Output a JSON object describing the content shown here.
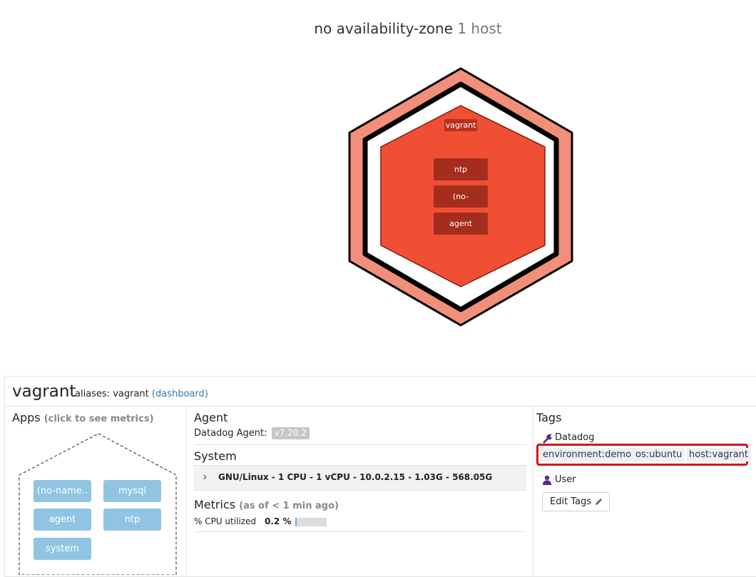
{
  "map": {
    "zone_title": "no availability-zone",
    "zone_count": "1 host",
    "host_label": "vagrant",
    "apps": [
      "ntp",
      "(no-",
      "agent"
    ],
    "colors": {
      "outer": "#f28f7a",
      "inner": "#f04f34",
      "app": "#a52d1d"
    }
  },
  "panel": {
    "host_name": "vagrant",
    "aliases_label": "aliases: vagrant",
    "dashboard_link": "(dashboard)",
    "apps": {
      "title": "Apps",
      "hint": "(click to see metrics)",
      "items": [
        "(no-name..",
        "mysql",
        "agent",
        "ntp",
        "system"
      ]
    },
    "agent": {
      "title": "Agent",
      "label": "Datadog Agent:",
      "version": "v7.20.2"
    },
    "system": {
      "title": "System",
      "summary": "GNU/Linux - 1 CPU - 1 vCPU - 10.0.2.15 - 1.03G - 568.05G"
    },
    "metrics": {
      "title": "Metrics",
      "as_of": "(as of < 1 min ago)",
      "cpu_label": "% CPU utilized",
      "cpu_value": "0.2 %",
      "cpu_fraction": 0.002
    },
    "tags": {
      "title": "Tags",
      "datadog_label": "Datadog",
      "items": [
        "environment:demo",
        "os:ubuntu",
        "host:vagrant"
      ],
      "user_label": "User",
      "edit_button": "Edit Tags",
      "highlight_color": "#d9121c"
    }
  }
}
